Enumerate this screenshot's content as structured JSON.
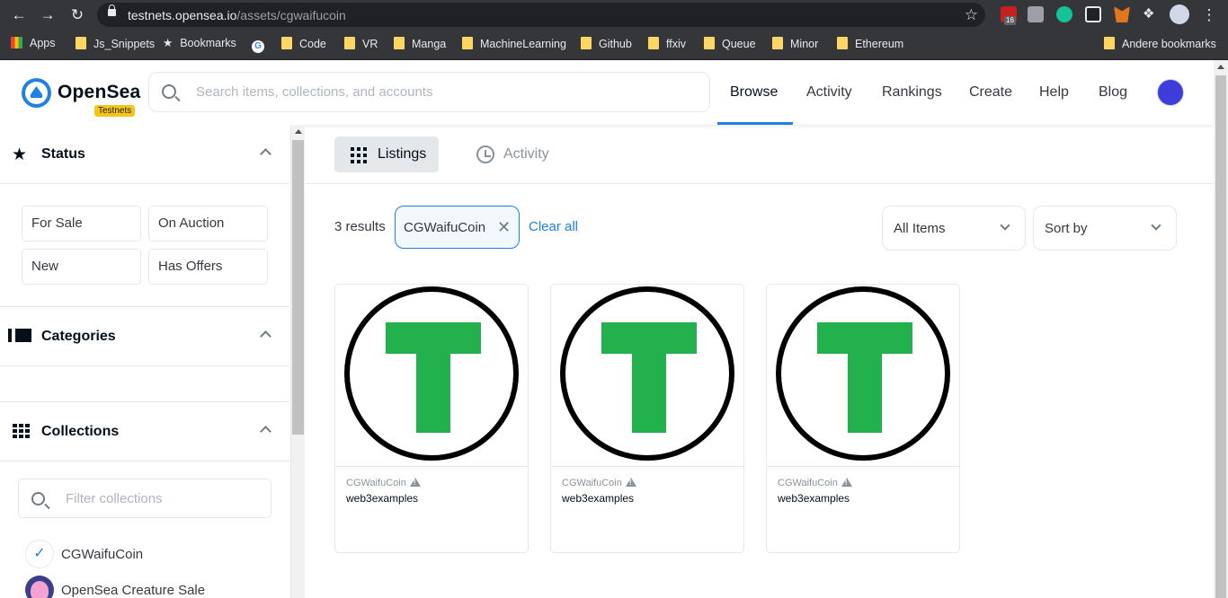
{
  "browser": {
    "url_host": "testnets.opensea.io",
    "url_path": "/assets/cgwaifucoin",
    "ext_badge": "16",
    "bookmarks": [
      "Apps",
      "Js_Snippets",
      "Bookmarks",
      "Code",
      "VR",
      "Manga",
      "MachineLearning",
      "Github",
      "ffxiv",
      "Queue",
      "Minor",
      "Ethereum"
    ],
    "other_bookmarks": "Andere bookmarks"
  },
  "header": {
    "brand": "OpenSea",
    "badge": "Testnets",
    "search_placeholder": "Search items, collections, and accounts",
    "nav": [
      "Browse",
      "Activity",
      "Rankings",
      "Create",
      "Help",
      "Blog"
    ],
    "active_nav": "Browse"
  },
  "sidebar": {
    "status_title": "Status",
    "status_filters": [
      "For Sale",
      "On Auction",
      "New",
      "Has Offers"
    ],
    "categories_title": "Categories",
    "collections_title": "Collections",
    "collections_placeholder": "Filter collections",
    "collections": [
      "CGWaifuCoin",
      "OpenSea Creature Sale"
    ]
  },
  "main": {
    "tabs": [
      "Listings",
      "Activity"
    ],
    "results": "3 results",
    "chip": "CGWaifuCoin",
    "clear_all": "Clear all",
    "items_dropdown": "All Items",
    "sort_dropdown": "Sort by",
    "cards": [
      {
        "collection": "CGWaifuCoin",
        "name": "web3examples"
      },
      {
        "collection": "CGWaifuCoin",
        "name": "web3examples"
      },
      {
        "collection": "CGWaifuCoin",
        "name": "web3examples"
      }
    ]
  },
  "colors": {
    "accent": "#2081e2",
    "token_green": "#22b14c",
    "chrome_dark": "#35363a"
  }
}
